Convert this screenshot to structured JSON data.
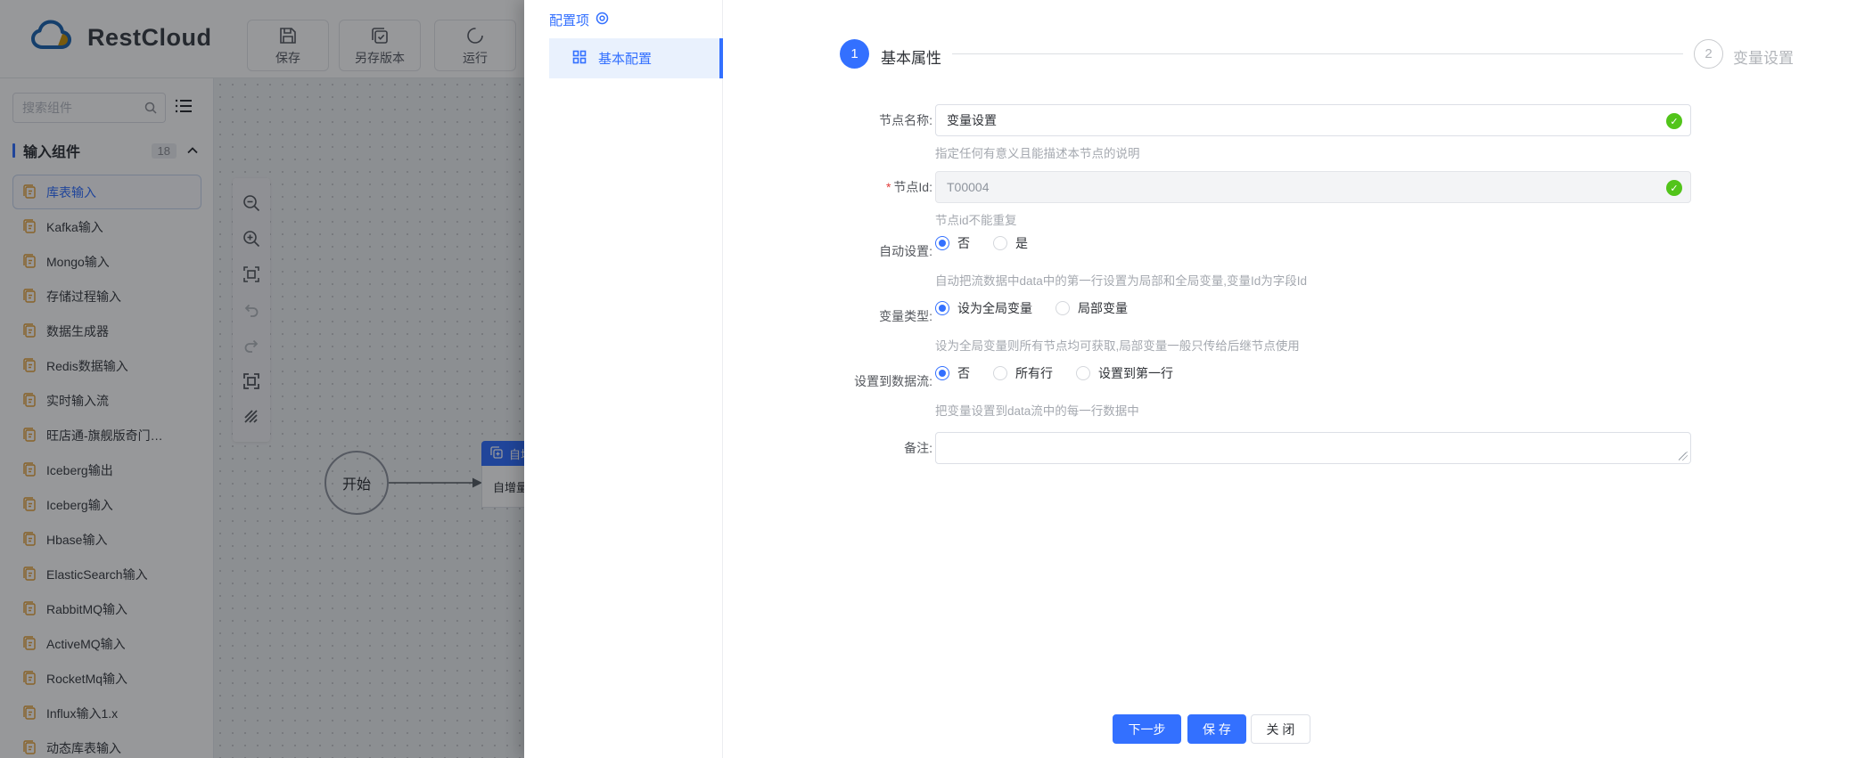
{
  "colors": {
    "primary": "#3370FF",
    "success": "#52C41A",
    "icon_orange": "#E6A23C"
  },
  "topbar": {
    "brand": "RestCloud",
    "actions": [
      {
        "icon": "save-icon",
        "label": "保存"
      },
      {
        "icon": "save-as-version-icon",
        "label": "另存版本"
      },
      {
        "icon": "run-icon",
        "label": "运行"
      }
    ]
  },
  "sidebar": {
    "search_placeholder": "搜索组件",
    "section": {
      "label": "输入组件",
      "count": "18"
    },
    "items": [
      {
        "label": "库表输入",
        "selected": true
      },
      {
        "label": "Kafka输入"
      },
      {
        "label": "Mongo输入"
      },
      {
        "label": "存储过程输入"
      },
      {
        "label": "数据生成器"
      },
      {
        "label": "Redis数据输入"
      },
      {
        "label": "实时输入流"
      },
      {
        "label": "旺店通-旗舰版奇门…"
      },
      {
        "label": "Iceberg输出"
      },
      {
        "label": "Iceberg输入"
      },
      {
        "label": "Hbase输入"
      },
      {
        "label": "ElasticSearch输入"
      },
      {
        "label": "RabbitMQ输入"
      },
      {
        "label": "ActiveMQ输入"
      },
      {
        "label": "RocketMq输入"
      },
      {
        "label": "Influx输入1.x"
      },
      {
        "label": "动态库表输入"
      }
    ]
  },
  "canvas": {
    "start_node": "开始",
    "flow_node": {
      "header": "自增",
      "body": "自增量"
    }
  },
  "drawer": {
    "nav_title": "配置项",
    "nav_selected": "基本配置",
    "steps": [
      {
        "num": "1",
        "label": "基本属性"
      },
      {
        "num": "2",
        "label": "变量设置"
      }
    ],
    "form": {
      "node_name": {
        "label": "节点名称:",
        "value": "变量设置",
        "helper": "指定任何有意义且能描述本节点的说明"
      },
      "node_id": {
        "label": "节点Id:",
        "required": "*",
        "value": "T00004",
        "helper": "节点id不能重复"
      },
      "auto_set": {
        "label": "自动设置:",
        "options": [
          {
            "label": "否",
            "checked": true
          },
          {
            "label": "是"
          }
        ],
        "helper": "自动把流数据中data中的第一行设置为局部和全局变量,变量Id为字段Id"
      },
      "var_type": {
        "label": "变量类型:",
        "options": [
          {
            "label": "设为全局变量",
            "checked": true
          },
          {
            "label": "局部变量"
          }
        ],
        "helper": "设为全局变量则所有节点均可获取,局部变量一般只传给后继节点使用"
      },
      "set_to_stream": {
        "label": "设置到数据流:",
        "options": [
          {
            "label": "否",
            "checked": true
          },
          {
            "label": "所有行"
          },
          {
            "label": "设置到第一行"
          }
        ],
        "helper": "把变量设置到data流中的每一行数据中"
      },
      "remark": {
        "label": "备注:",
        "value": ""
      }
    },
    "footer": {
      "next": "下一步",
      "save": "保 存",
      "close": "关 闭"
    }
  }
}
